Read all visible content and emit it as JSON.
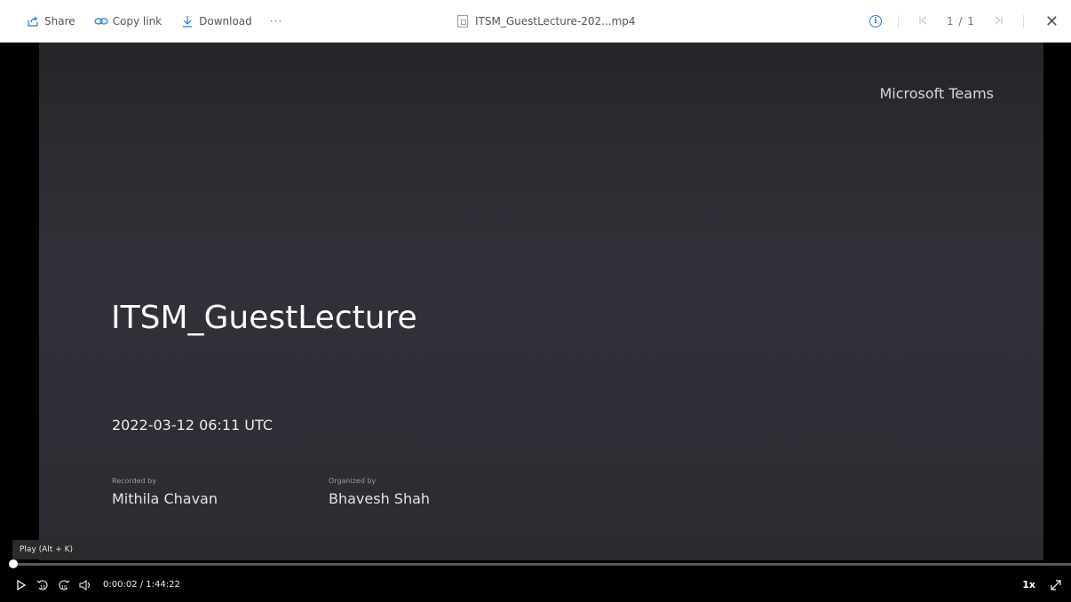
{
  "toolbar": {
    "share_label": "Share",
    "copylink_label": "Copy link",
    "download_label": "Download",
    "more_label": "···",
    "file_name": "ITSM_GuestLecture-202...mp4",
    "info_icon": "info-icon",
    "pager": "1 / 1",
    "close_label": "✕"
  },
  "video": {
    "brand": "Microsoft Teams",
    "title": "ITSM_GuestLecture",
    "datetime": "2022-03-12 06:11 UTC",
    "recorded_by_label": "Recorded by",
    "recorded_by_name": "Mithila Chavan",
    "organized_by_label": "Organized by",
    "organized_by_name": "Bhavesh Shah"
  },
  "player": {
    "tooltip": "Play (Alt + K)",
    "current_time": "0:00:02",
    "duration": "1:44:22",
    "time_display": "0:00:02  /  1:44:22",
    "progress_fraction": 0.0003,
    "speed": "1x",
    "skip_back_label": "10",
    "skip_forward_label": "10"
  },
  "colors": {
    "accent": "#2b78d0",
    "video_bg": "#2f2f37",
    "toolbar_bg": "#ffffff"
  }
}
